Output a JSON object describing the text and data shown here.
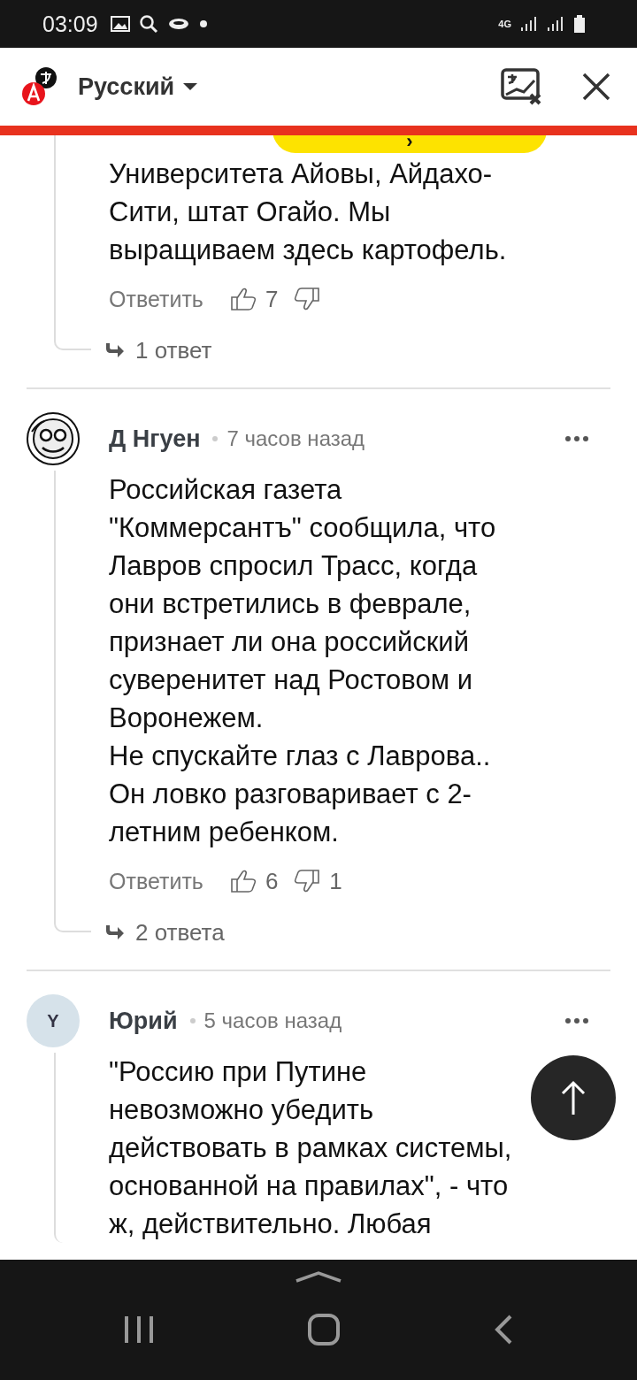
{
  "status_bar": {
    "time": "03:09",
    "network": "4G"
  },
  "translate_bar": {
    "language": "Русский",
    "pill_icon": "›"
  },
  "comments": [
    {
      "kind": "partial",
      "body": "Университета Айовы, Айдахо-\nСити, штат Огайо. Мы\nвыращиваем здесь картофель.",
      "reply_label": "Ответить",
      "likes": "7",
      "replies": "1 ответ"
    },
    {
      "kind": "full",
      "author": "Д Нгуен",
      "time": "7 часов назад",
      "body": "Российская газета\n\"Коммерсантъ\" сообщила, что\nЛавров спросил Трасс, когда\nони встретились в феврале,\nпризнает ли она российский\nсуверенитет над Ростовом и\nВоронежем.\nНе спускайте глаз с Лаврова..\nОн ловко разговаривает с 2-\nлетним ребенком.",
      "reply_label": "Ответить",
      "likes": "6",
      "dislikes": "1",
      "replies": "2 ответа"
    },
    {
      "kind": "full",
      "initial": "Y",
      "author": "Юрий",
      "time": "5 часов назад",
      "body": "\"Россию при Путине\nневозможно убедить\nдействовать в рамках системы,\nоснованной на правилах\", - что\nж, действительно. Любая"
    }
  ]
}
